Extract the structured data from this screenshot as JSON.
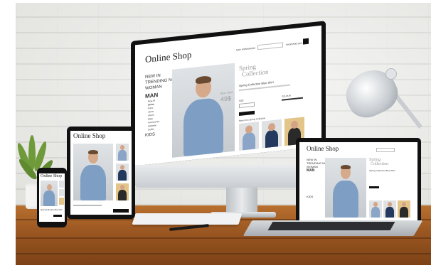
{
  "scene": {
    "wall_color": "#e9e9e6",
    "table_color": "#9a5621"
  },
  "desktop": {
    "brand": "Online Shop",
    "nav": [
      "NEW IN",
      "TRENDING NOW",
      "WOMAN",
      "MAN",
      "KIDS"
    ],
    "submenu": [
      "New All",
      "Shirts",
      "Polos",
      "Jeans",
      "Shoes",
      "Bags",
      "Accessories",
      "Knitwear",
      "Outfits"
    ],
    "promo_line1": "Spring",
    "promo_line2": "Collection",
    "product_title": "Spring Collection Blue Shirt",
    "photo_label": "Blue Shirt",
    "photo_price": "49$",
    "size_label": "SIZE",
    "colour_label": "COLOUR",
    "related_label": "More from Spring Collection",
    "header_links": [
      "MAN",
      "WOMAN",
      "KIDS"
    ],
    "bag_label": "SHOPPING BAG"
  },
  "tablet": {
    "brand": "Online Shop"
  },
  "phone": {
    "brand": "Online Shop",
    "product_title": "Spring Collection Blue Shirt"
  },
  "laptop": {
    "brand": "Online Shop",
    "nav": [
      "NEW IN",
      "TRENDING NOW",
      "WOMAN",
      "MAN",
      "KIDS"
    ],
    "promo_line1": "Spring",
    "promo_line2": "Collection",
    "product_title": "Spring Collection Blue Shirt"
  },
  "colors": {
    "shirt_blue": "#7e9ec4",
    "accent_grey": "#9b9b9b",
    "screen_bezel": "#111111"
  },
  "icons": [
    "plant-icon",
    "desk-lamp-icon",
    "keyboard-icon",
    "pen-icon"
  ]
}
